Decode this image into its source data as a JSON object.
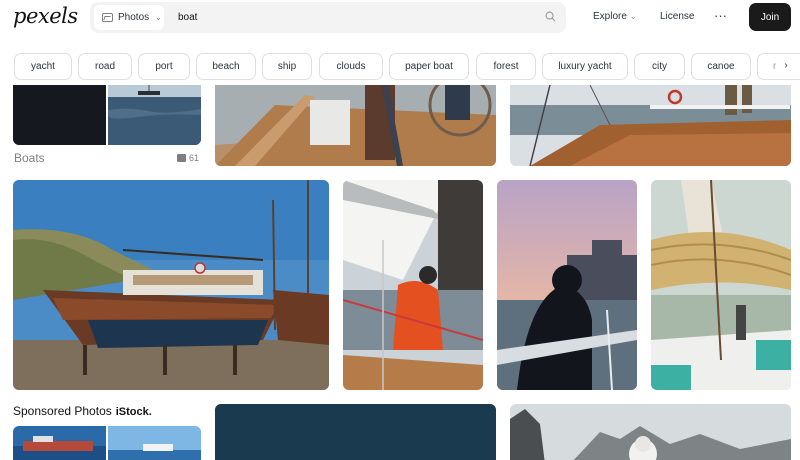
{
  "header": {
    "logo": "pexels",
    "search_type": "Photos",
    "search_value": "boat",
    "nav_explore": "Explore",
    "nav_license": "License",
    "nav_more": "···",
    "join": "Join"
  },
  "chips": [
    "yacht",
    "road",
    "port",
    "beach",
    "ship",
    "clouds",
    "paper boat",
    "forest",
    "luxury yacht",
    "city",
    "canoe",
    "m"
  ],
  "collection": {
    "title": "Boats",
    "count": "61"
  },
  "sponsored": {
    "title": "Sponsored Photos",
    "brand": "iStock."
  },
  "colors": {
    "join_bg": "#1a1a1a",
    "chip_border": "#dfdfe0",
    "search_bg": "#f3f3f3"
  }
}
